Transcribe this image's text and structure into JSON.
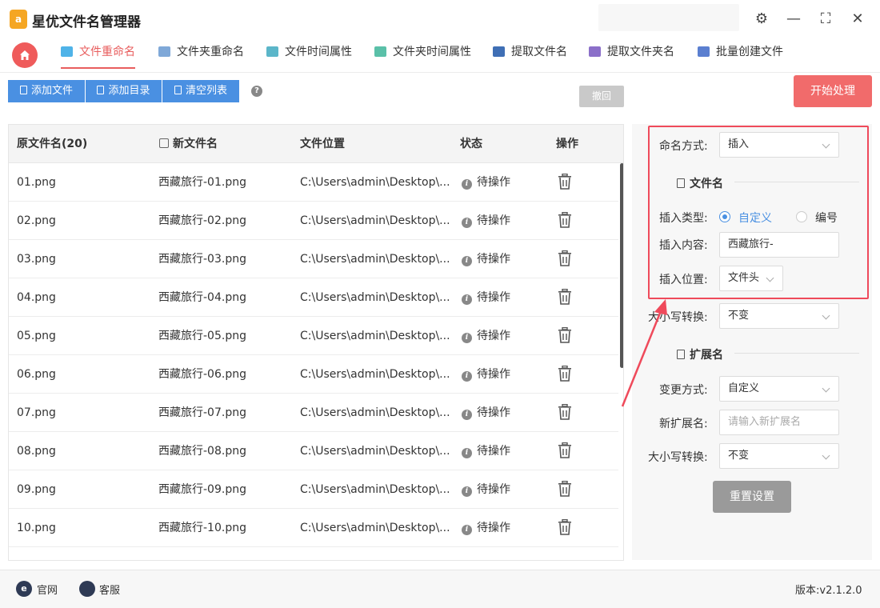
{
  "app": {
    "title": "星优文件名管理器",
    "logo_glyph": "a"
  },
  "window": {
    "settings_glyph": "⚙",
    "minimize_glyph": "—",
    "maximize_glyph": "⛶",
    "close_glyph": "✕"
  },
  "nav": {
    "tabs": [
      {
        "label": "文件重命名",
        "active": true,
        "color": "#4fb3e8"
      },
      {
        "label": "文件夹重命名",
        "active": false,
        "color": "#7fa8d8"
      },
      {
        "label": "文件时间属性",
        "active": false,
        "color": "#5bb6c9"
      },
      {
        "label": "文件夹时间属性",
        "active": false,
        "color": "#5ac0a8"
      },
      {
        "label": "提取文件名",
        "active": false,
        "color": "#3f6fb5"
      },
      {
        "label": "提取文件夹名",
        "active": false,
        "color": "#8b6fc9"
      },
      {
        "label": "批量创建文件",
        "active": false,
        "color": "#5b7fd0"
      }
    ]
  },
  "toolbar": {
    "add_file": "添加文件",
    "add_dir": "添加目录",
    "clear_list": "清空列表",
    "help": "?",
    "undo": "撤回",
    "start": "开始处理"
  },
  "table": {
    "headers": {
      "original": "原文件名(20)",
      "new_name": "新文件名",
      "location": "文件位置",
      "status": "状态",
      "action": "操作"
    },
    "rows": [
      {
        "original": "01.png",
        "new_name": "西藏旅行-01.png",
        "location": "C:\\Users\\admin\\Desktop\\...",
        "status": "待操作"
      },
      {
        "original": "02.png",
        "new_name": "西藏旅行-02.png",
        "location": "C:\\Users\\admin\\Desktop\\...",
        "status": "待操作"
      },
      {
        "original": "03.png",
        "new_name": "西藏旅行-03.png",
        "location": "C:\\Users\\admin\\Desktop\\...",
        "status": "待操作"
      },
      {
        "original": "04.png",
        "new_name": "西藏旅行-04.png",
        "location": "C:\\Users\\admin\\Desktop\\...",
        "status": "待操作"
      },
      {
        "original": "05.png",
        "new_name": "西藏旅行-05.png",
        "location": "C:\\Users\\admin\\Desktop\\...",
        "status": "待操作"
      },
      {
        "original": "06.png",
        "new_name": "西藏旅行-06.png",
        "location": "C:\\Users\\admin\\Desktop\\...",
        "status": "待操作"
      },
      {
        "original": "07.png",
        "new_name": "西藏旅行-07.png",
        "location": "C:\\Users\\admin\\Desktop\\...",
        "status": "待操作"
      },
      {
        "original": "08.png",
        "new_name": "西藏旅行-08.png",
        "location": "C:\\Users\\admin\\Desktop\\...",
        "status": "待操作"
      },
      {
        "original": "09.png",
        "new_name": "西藏旅行-09.png",
        "location": "C:\\Users\\admin\\Desktop\\...",
        "status": "待操作"
      },
      {
        "original": "10.png",
        "new_name": "西藏旅行-10.png",
        "location": "C:\\Users\\admin\\Desktop\\...",
        "status": "待操作"
      }
    ]
  },
  "settings": {
    "naming_method_label": "命名方式:",
    "naming_method_value": "插入",
    "filename_section": "文件名",
    "insert_type_label": "插入类型:",
    "insert_type_options": [
      "自定义",
      "编号"
    ],
    "insert_type_selected": "自定义",
    "insert_content_label": "插入内容:",
    "insert_content_value": "西藏旅行-",
    "insert_position_label": "插入位置:",
    "insert_position_value": "文件头",
    "case_label": "大小写转换:",
    "case_value": "不变",
    "ext_section": "扩展名",
    "change_method_label": "变更方式:",
    "change_method_value": "自定义",
    "new_ext_label": "新扩展名:",
    "new_ext_placeholder": "请输入新扩展名",
    "ext_case_label": "大小写转换:",
    "ext_case_value": "不变",
    "reset": "重置设置"
  },
  "footer": {
    "website": "官网",
    "website_glyph": "e",
    "support": "客服",
    "version": "版本:v2.1.2.0"
  },
  "colors": {
    "accent_red": "#e85d5d",
    "primary_blue": "#4a90e2",
    "highlight": "#ef4a5b"
  }
}
